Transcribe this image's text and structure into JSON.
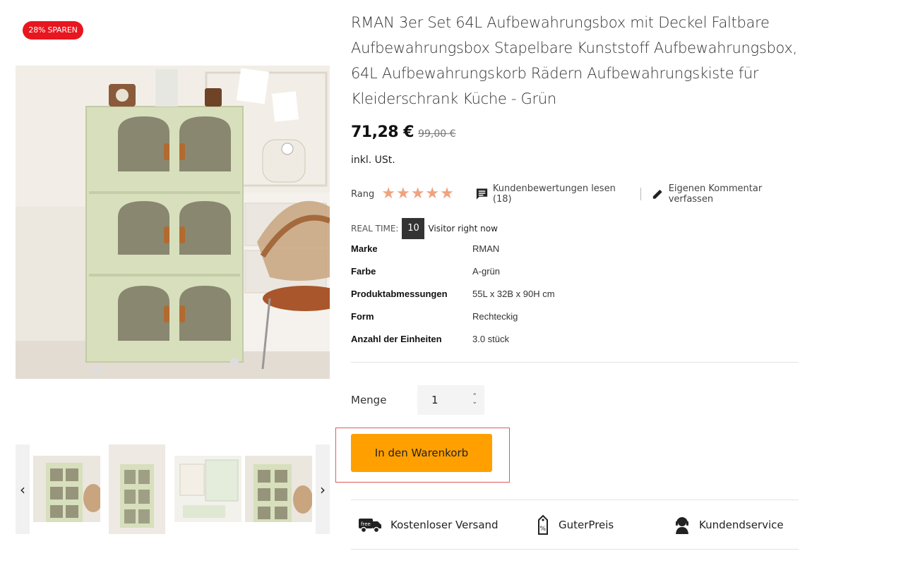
{
  "badge": {
    "label": "28% SPAREN"
  },
  "product": {
    "title": "RMAN 3er Set 64L Aufbewahrungsbox mit Deckel Faltbare Aufbewahrungsbox Stapelbare Kunststoff Aufbewahrungsbox, 64L Aufbewahrungskorb Rädern Aufbewahrungskiste für Kleiderschrank Küche - Grün",
    "price": "71,28 €",
    "old_price": "99,00 €",
    "tax_note": "inkl. USt."
  },
  "rating": {
    "label": "Rang",
    "stars": 5,
    "review_link": "Kundenbewertungen lesen (18)",
    "comment_link": "Eigenen Kommentar verfassen"
  },
  "realtime": {
    "label": "REAL TIME:",
    "count": "10",
    "text": "Visitor right now"
  },
  "specs": [
    {
      "key": "Marke",
      "value": "RMAN"
    },
    {
      "key": "Farbe",
      "value": "A-grün"
    },
    {
      "key": "Produktabmessungen",
      "value": "55L x 32B x 90H cm"
    },
    {
      "key": "Form",
      "value": "Rechteckig"
    },
    {
      "key": "Anzahl der Einheiten",
      "value": "3.0 stück"
    }
  ],
  "quantity": {
    "label": "Menge",
    "value": "1"
  },
  "cart": {
    "label": "In den Warenkorb"
  },
  "features": [
    {
      "label": "Kostenloser Versand",
      "icon": "free-shipping-truck-icon"
    },
    {
      "label": "GuterPreis",
      "icon": "price-tag-icon"
    },
    {
      "label": "Kundendservice",
      "icon": "customer-service-icon"
    }
  ],
  "thumbnails": {
    "prev": "‹",
    "next": "›"
  },
  "colors": {
    "badge": "#e8161f",
    "cart": "#ffa000",
    "stars": "#f0a37f",
    "cabinet": "#d4dcb8"
  }
}
